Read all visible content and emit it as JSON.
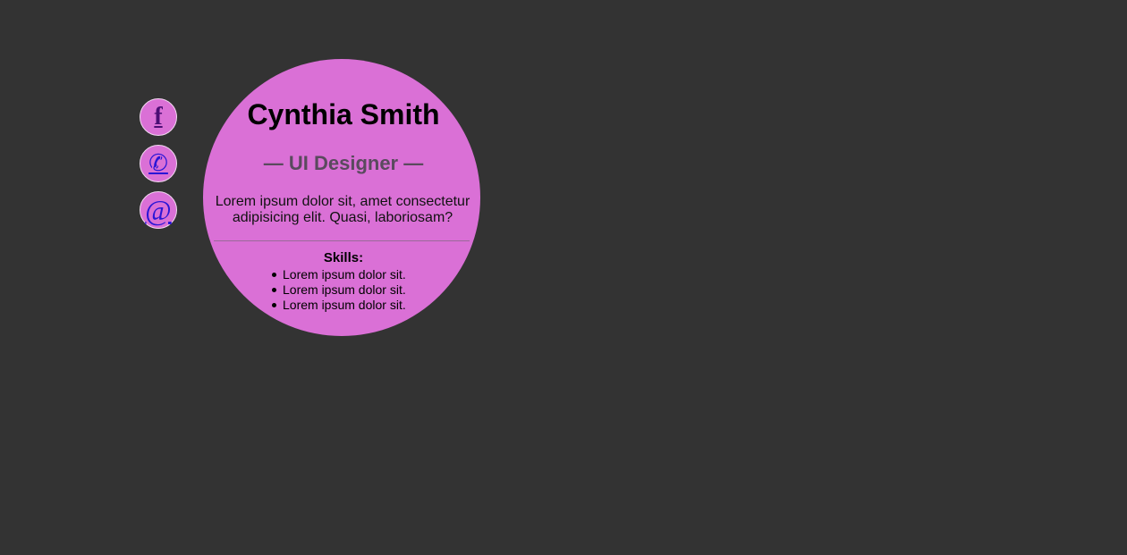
{
  "social": {
    "facebook_glyph": "f",
    "phone_glyph": "✆",
    "email_glyph": "@"
  },
  "profile": {
    "name": "Cynthia Smith",
    "role": "— UI Designer —",
    "bio": "Lorem ipsum dolor sit, amet consectetur adipisicing elit. Quasi, laboriosam?",
    "skills_title": "Skills:",
    "skills": [
      "Lorem ipsum dolor sit.",
      "Lorem ipsum dolor sit.",
      "Lorem ipsum dolor sit."
    ]
  },
  "colors": {
    "background": "#333333",
    "card": "#da70d6",
    "icon_link": "#2a16d6",
    "role_text": "#5a4a5e"
  }
}
